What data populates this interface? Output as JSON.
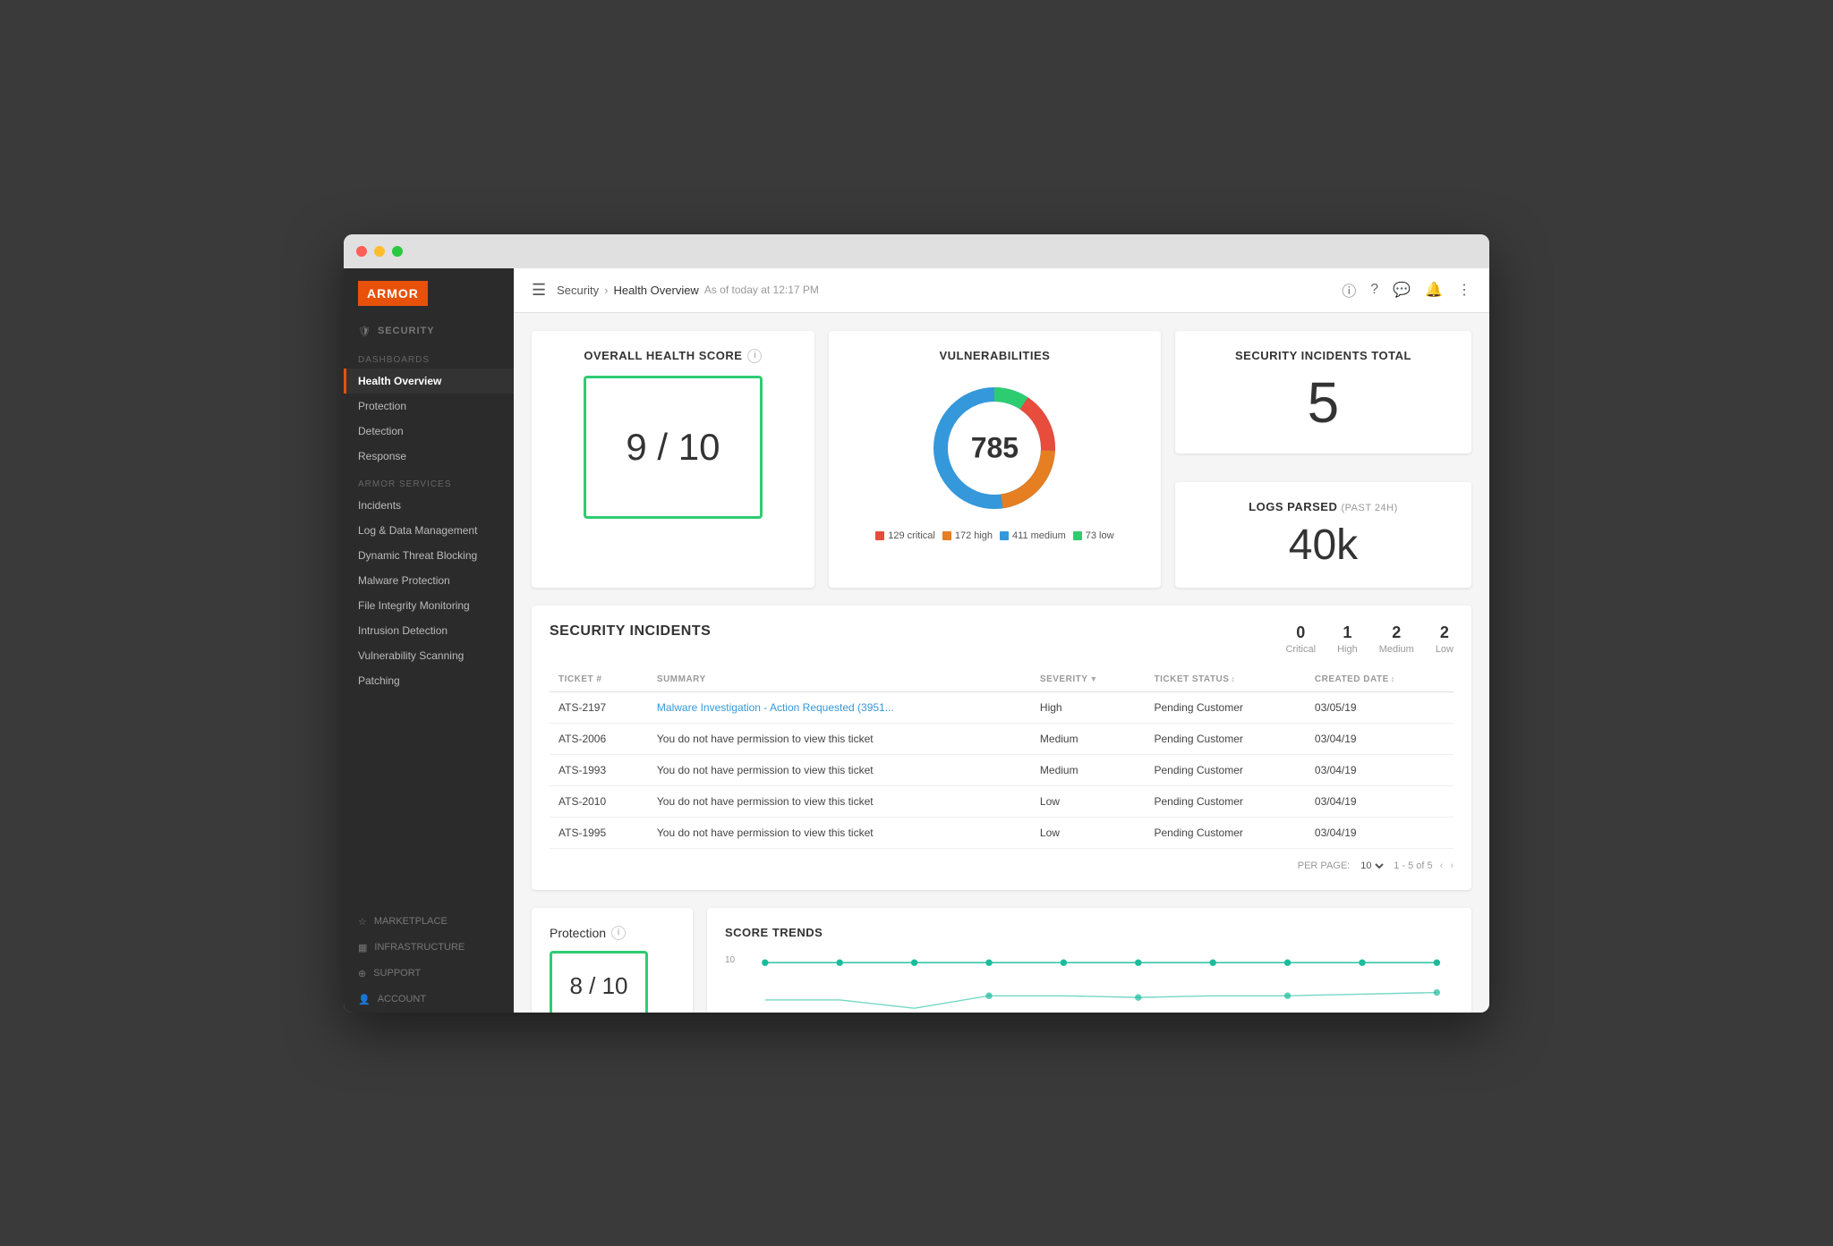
{
  "window": {
    "titlebar": {
      "dots": [
        "red",
        "yellow",
        "green"
      ]
    }
  },
  "sidebar": {
    "logo": "ARMOR",
    "sections": [
      {
        "label": "SECURITY",
        "icon": "shield",
        "items": []
      },
      {
        "label": "DASHBOARDS",
        "items": [
          {
            "id": "health-overview",
            "label": "Health Overview",
            "active": true
          },
          {
            "id": "protection",
            "label": "Protection",
            "active": false
          },
          {
            "id": "detection",
            "label": "Detection",
            "active": false
          },
          {
            "id": "response",
            "label": "Response",
            "active": false
          }
        ]
      },
      {
        "label": "ARMOR SERVICES",
        "items": [
          {
            "id": "incidents",
            "label": "Incidents"
          },
          {
            "id": "log-data",
            "label": "Log & Data Management"
          },
          {
            "id": "dynamic-threat",
            "label": "Dynamic Threat Blocking"
          },
          {
            "id": "malware",
            "label": "Malware Protection"
          },
          {
            "id": "file-integrity",
            "label": "File Integrity Monitoring"
          },
          {
            "id": "intrusion",
            "label": "Intrusion Detection"
          },
          {
            "id": "vulnerability",
            "label": "Vulnerability Scanning"
          },
          {
            "id": "patching",
            "label": "Patching"
          }
        ]
      }
    ],
    "bottom_sections": [
      {
        "id": "marketplace",
        "label": "MARKETPLACE",
        "icon": "star"
      },
      {
        "id": "infrastructure",
        "label": "INFRASTRUCTURE",
        "icon": "grid"
      },
      {
        "id": "support",
        "label": "SUPPORT",
        "icon": "circle"
      },
      {
        "id": "account",
        "label": "ACCOUNT",
        "icon": "person"
      }
    ]
  },
  "topbar": {
    "hamburger": "☰",
    "breadcrumb": {
      "root": "Security",
      "current": "Health Overview",
      "sub": "As of today at 12:17 PM"
    },
    "icons": [
      "info",
      "help",
      "chat",
      "bell",
      "more"
    ]
  },
  "health_score": {
    "title": "OVERALL HEALTH SCORE",
    "value": "9 / 10"
  },
  "vulnerabilities": {
    "title": "VULNERABILITIES",
    "total": "785",
    "segments": [
      {
        "label": "129 critical",
        "color": "#e74c3c",
        "value": 129
      },
      {
        "label": "172 high",
        "color": "#e67e22",
        "value": 172
      },
      {
        "label": "411 medium",
        "color": "#3498db",
        "value": 411
      },
      {
        "label": "73 low",
        "color": "#2ecc71",
        "value": 73
      }
    ]
  },
  "security_incidents_total": {
    "label": "SECURITY INCIDENTS TOTAL",
    "value": "5"
  },
  "logs_parsed": {
    "label": "LOGS PARSED",
    "sublabel": "(PAST 24H)",
    "value": "40k"
  },
  "security_incidents_section": {
    "title": "SECURITY INCIDENTS",
    "severity_summary": [
      {
        "count": "0",
        "label": "Critical"
      },
      {
        "count": "1",
        "label": "High"
      },
      {
        "count": "2",
        "label": "Medium"
      },
      {
        "count": "2",
        "label": "Low"
      }
    ],
    "table": {
      "columns": [
        {
          "id": "ticket",
          "label": "TICKET #"
        },
        {
          "id": "summary",
          "label": "SUMMARY"
        },
        {
          "id": "severity",
          "label": "SEVERITY",
          "sortable": true
        },
        {
          "id": "status",
          "label": "TICKET STATUS",
          "sortable": true
        },
        {
          "id": "created",
          "label": "CREATED DATE",
          "sortable": true
        }
      ],
      "rows": [
        {
          "ticket": "ATS-2197",
          "summary": "Malware Investigation - Action Requested (3951...",
          "severity": "High",
          "status": "Pending Customer",
          "created": "03/05/19",
          "link": true
        },
        {
          "ticket": "ATS-2006",
          "summary": "You do not have permission to view this ticket",
          "severity": "Medium",
          "status": "Pending Customer",
          "created": "03/04/19",
          "link": false
        },
        {
          "ticket": "ATS-1993",
          "summary": "You do not have permission to view this ticket",
          "severity": "Medium",
          "status": "Pending Customer",
          "created": "03/04/19",
          "link": false
        },
        {
          "ticket": "ATS-2010",
          "summary": "You do not have permission to view this ticket",
          "severity": "Low",
          "status": "Pending Customer",
          "created": "03/04/19",
          "link": false
        },
        {
          "ticket": "ATS-1995",
          "summary": "You do not have permission to view this ticket",
          "severity": "Low",
          "status": "Pending Customer",
          "created": "03/04/19",
          "link": false
        }
      ]
    },
    "pagination": {
      "per_page_label": "PER PAGE:",
      "per_page_value": "10",
      "range": "1 - 5 of 5"
    }
  },
  "protection_section": {
    "label": "Protection",
    "score": "8 / 10"
  },
  "score_trends": {
    "title": "SCORE TRENDS",
    "y_label": "10",
    "line1_points": "30,20 120,20 210,20 300,20 390,20 480,20 570,20 660,20 750,20 840,20",
    "line2_points": "30,38 120,38 210,50 300,38 390,38 480,38 570,38 660,38 750,38 840,38"
  }
}
